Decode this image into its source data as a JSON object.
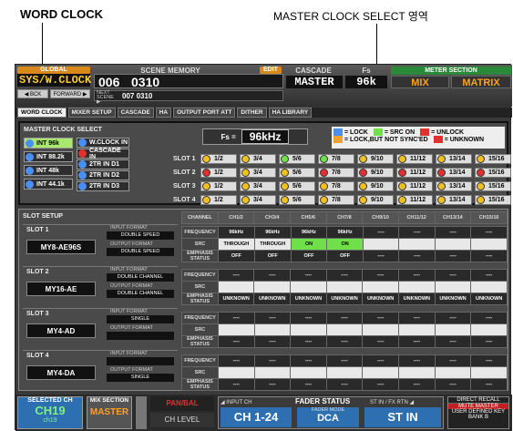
{
  "annotations": {
    "left_label": "WORD CLOCK",
    "right_label": "MASTER CLOCK SELECT 영역"
  },
  "header": {
    "global_tag": "GLOBAL",
    "screen_name": "SYS/W.CLOCK",
    "back_btn": "◀ BCK",
    "forward_btn": "FORWARD ▶",
    "scene_memory_label": "SCENE MEMORY",
    "edit_tag": "EDIT",
    "scene_number": "006",
    "scene_title": "0310",
    "next_scene_label": "NEXT SCENE ▶",
    "next_scene": "007 0310",
    "cascade_label": "CASCADE",
    "cascade_value": "MASTER",
    "fs_label": "Fs",
    "fs_value": "96k",
    "meter_section_label": "METER SECTION",
    "meter_mix": "MIX",
    "meter_matrix": "MATRIX"
  },
  "tabs": [
    "WORD CLOCK",
    "MIXER SETUP",
    "CASCADE",
    "HA",
    "OUTPUT PORT ATT",
    "DITHER",
    "HA LIBRARY"
  ],
  "master_clock": {
    "title": "MASTER CLOCK SELECT",
    "fs_label": "Fs =",
    "fs_value": "96kHz",
    "sources_left": [
      {
        "label": "INT 96k",
        "color": "#4a8ff0",
        "selected": true
      },
      {
        "label": "INT 88.2k",
        "color": "#4a8ff0",
        "selected": false
      },
      {
        "label": "INT 48k",
        "color": "#4a8ff0",
        "selected": false
      },
      {
        "label": "INT 44.1k",
        "color": "#4a8ff0",
        "selected": false
      }
    ],
    "sources_right": [
      {
        "label": "W.CLOCK IN",
        "color": "#4a8ff0"
      },
      {
        "label": "CASCADE IN",
        "color": "#e03030"
      },
      {
        "label": "2TR IN D1",
        "color": "#4a8ff0"
      },
      {
        "label": "2TR IN D2",
        "color": "#4a8ff0"
      },
      {
        "label": "2TR IN D3",
        "color": "#4a8ff0"
      }
    ],
    "legend": [
      {
        "label": "= LOCK",
        "color": "#4a8ff0"
      },
      {
        "label": "= SRC ON",
        "color": "#6fe04a"
      },
      {
        "label": "= UNLOCK",
        "color": "#e03030"
      },
      {
        "label": "= LOCK,BUT NOT SYNC'ED",
        "color": "#f0a030"
      },
      {
        "label": "= UNKNOWN",
        "color": "#e03030"
      }
    ],
    "slots": [
      {
        "label": "SLOT 1",
        "channels": [
          {
            "label": "1/2",
            "color": "#f0c020"
          },
          {
            "label": "3/4",
            "color": "#f0c020"
          },
          {
            "label": "5/6",
            "color": "#6fe04a"
          },
          {
            "label": "7/8",
            "color": "#6fe04a"
          },
          {
            "label": "9/10",
            "color": "#f0c020"
          },
          {
            "label": "11/12",
            "color": "#f0c020"
          },
          {
            "label": "13/14",
            "color": "#f0c020"
          },
          {
            "label": "15/16",
            "color": "#f0c020"
          }
        ]
      },
      {
        "label": "SLOT 2",
        "channels": [
          {
            "label": "1/2",
            "color": "#e03030"
          },
          {
            "label": "3/4",
            "color": "#f0c020"
          },
          {
            "label": "5/6",
            "color": "#f0c020"
          },
          {
            "label": "7/8",
            "color": "#e03030"
          },
          {
            "label": "9/10",
            "color": "#e03030"
          },
          {
            "label": "11/12",
            "color": "#e03030"
          },
          {
            "label": "13/14",
            "color": "#e03030"
          },
          {
            "label": "15/16",
            "color": "#e03030"
          }
        ]
      },
      {
        "label": "SLOT 3",
        "channels": [
          {
            "label": "1/2",
            "color": "#f0c020"
          },
          {
            "label": "3/4",
            "color": "#f0c020"
          },
          {
            "label": "5/6",
            "color": "#f0c020"
          },
          {
            "label": "7/8",
            "color": "#f0c020"
          },
          {
            "label": "9/10",
            "color": "#f0c020"
          },
          {
            "label": "11/12",
            "color": "#f0c020"
          },
          {
            "label": "13/14",
            "color": "#f0c020"
          },
          {
            "label": "15/16",
            "color": "#f0c020"
          }
        ]
      },
      {
        "label": "SLOT 4",
        "channels": [
          {
            "label": "1/2",
            "color": "#f0c020"
          },
          {
            "label": "3/4",
            "color": "#f0c020"
          },
          {
            "label": "5/6",
            "color": "#f0c020"
          },
          {
            "label": "7/8",
            "color": "#f0c020"
          },
          {
            "label": "9/10",
            "color": "#f0c020"
          },
          {
            "label": "11/12",
            "color": "#f0c020"
          },
          {
            "label": "13/14",
            "color": "#f0c020"
          },
          {
            "label": "15/16",
            "color": "#f0c020"
          }
        ]
      }
    ]
  },
  "slot_setup": {
    "title": "SLOT SETUP",
    "columns": [
      "CHANNEL",
      "CH1/2",
      "CH3/4",
      "CH5/6",
      "CH7/8",
      "CH9/10",
      "CH11/12",
      "CH13/14",
      "CH15/16"
    ],
    "row_labels": [
      "FREQUENCY",
      "SRC",
      "EMPHASIS STATUS"
    ],
    "input_format_label": "INPUT FORMAT",
    "output_format_label": "OUTPUT FORMAT",
    "slots": [
      {
        "label": "SLOT 1",
        "card": "MY8-AE96S",
        "input_format": "DOUBLE SPEED",
        "output_format": "DOUBLE SPEED",
        "frequency": [
          "96kHz",
          "96kHz",
          "96kHz",
          "96kHz",
          "----",
          "----",
          "----",
          "----"
        ],
        "src": [
          "THROUGH",
          "THROUGH",
          "ON",
          "ON",
          "",
          "",
          "",
          ""
        ],
        "emphasis": [
          "OFF",
          "OFF",
          "OFF",
          "OFF",
          "----",
          "----",
          "----",
          "----"
        ]
      },
      {
        "label": "SLOT 2",
        "card": "MY16-AE",
        "input_format": "DOUBLE CHANNEL",
        "output_format": "DOUBLE CHANNEL",
        "frequency": [
          "----",
          "----",
          "----",
          "----",
          "----",
          "----",
          "----",
          "----"
        ],
        "src": [
          "",
          "",
          "",
          "",
          "",
          "",
          "",
          ""
        ],
        "emphasis": [
          "UNKNOWN",
          "UNKNOWN",
          "UNKNOWN",
          "UNKNOWN",
          "UNKNOWN",
          "UNKNOWN",
          "UNKNOWN",
          "UNKNOWN"
        ]
      },
      {
        "label": "SLOT 3",
        "card": "MY4-AD",
        "input_format": "SINGLE",
        "output_format": "",
        "frequency": [
          "----",
          "----",
          "----",
          "----",
          "----",
          "----",
          "----",
          "----"
        ],
        "src": [
          "",
          "",
          "",
          "",
          "",
          "",
          "",
          ""
        ],
        "emphasis": [
          "----",
          "----",
          "----",
          "----",
          "----",
          "----",
          "----",
          "----"
        ]
      },
      {
        "label": "SLOT 4",
        "card": "MY4-DA",
        "input_format": "",
        "output_format": "SINGLE",
        "frequency": [
          "----",
          "----",
          "----",
          "----",
          "----",
          "----",
          "----",
          "----"
        ],
        "src": [
          "",
          "",
          "",
          "",
          "",
          "",
          "",
          ""
        ],
        "emphasis": [
          "----",
          "----",
          "----",
          "----",
          "----",
          "----",
          "----",
          "----"
        ]
      }
    ]
  },
  "bottom": {
    "selected_ch_label": "SELECTED CH",
    "selected_ch": "CH19",
    "selected_ch_sub": "ch19",
    "mix_section_label": "MIX SECTION",
    "mix_value": "MASTER",
    "pan_bal": "PAN/BAL",
    "ch_level": "CH LEVEL",
    "fader_status_label": "FADER STATUS",
    "input_ch_label": "◢ INPUT CH",
    "input_ch_value": "CH 1-24",
    "fader_mode_label": "FADER MODE",
    "fader_mode_value": "DCA",
    "st_in_label": "ST IN / FX RTN ◢",
    "st_in_value": "ST IN",
    "direct_recall": "DIRECT RECALL",
    "mute_master": "MUTE MASTER",
    "user_defined": "USER DEFINED KEY",
    "bank": "BANK B"
  }
}
